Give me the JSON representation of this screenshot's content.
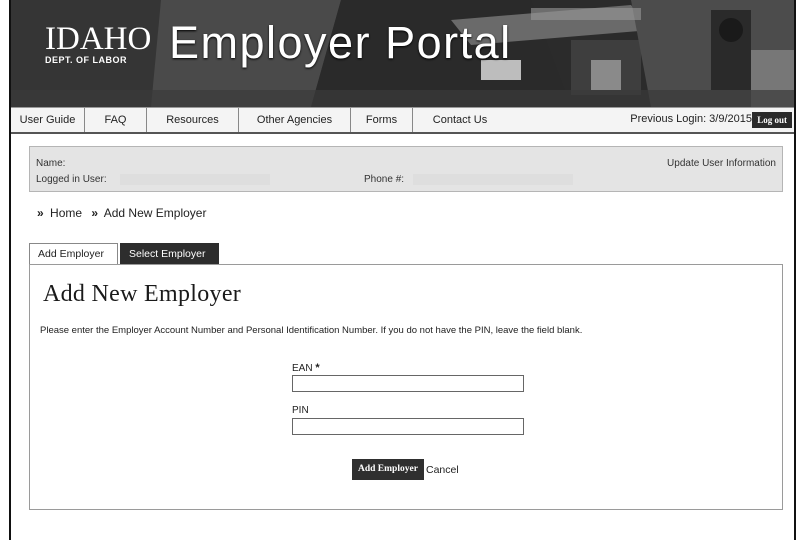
{
  "header": {
    "logo_main": "IDAHO",
    "logo_sub": "DEPT. OF LABOR",
    "title": "Employer Portal"
  },
  "nav": {
    "items": [
      {
        "label": "User Guide"
      },
      {
        "label": "FAQ"
      },
      {
        "label": "Resources"
      },
      {
        "label": "Other Agencies"
      },
      {
        "label": "Forms"
      },
      {
        "label": "Contact Us"
      }
    ],
    "previous_login": "Previous Login: 3/9/2015",
    "logout": "Log out"
  },
  "user_info": {
    "name_label": "Name:",
    "logged_in_label": "Logged in User:",
    "phone_label": "Phone #:",
    "update_link": "Update User Information"
  },
  "breadcrumb": {
    "separator": "»",
    "home": "Home",
    "current": "Add New Employer"
  },
  "tabs": [
    {
      "label": "Add Employer",
      "active": true
    },
    {
      "label": "Select Employer",
      "active": false
    }
  ],
  "form": {
    "heading": "Add New Employer",
    "instructions": "Please enter the Employer Account Number and Personal Identification Number. If you do not have the PIN, leave the field blank.",
    "ean_label": "EAN",
    "ean_required_mark": "*",
    "ean_value": "",
    "pin_label": "PIN",
    "pin_value": "",
    "submit_label": "Add Employer",
    "cancel_label": "Cancel"
  }
}
